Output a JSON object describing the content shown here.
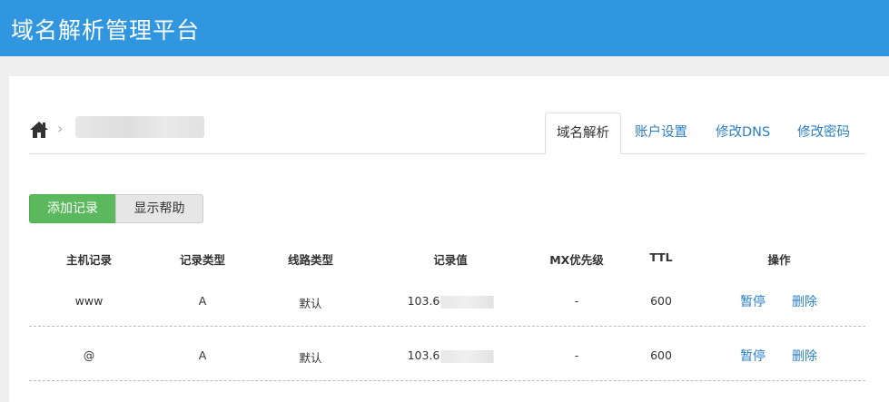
{
  "header": {
    "title": "域名解析管理平台"
  },
  "breadcrumb": {
    "home_icon": "home-icon",
    "separator": "›",
    "domain": ""
  },
  "tabs": [
    {
      "label": "域名解析",
      "active": true
    },
    {
      "label": "账户设置",
      "active": false
    },
    {
      "label": "修改DNS",
      "active": false
    },
    {
      "label": "修改密码",
      "active": false
    }
  ],
  "toolbar": {
    "add_label": "添加记录",
    "help_label": "显示帮助"
  },
  "table": {
    "headers": [
      "主机记录",
      "记录类型",
      "线路类型",
      "记录值",
      "MX优先级",
      "TTL",
      "操作"
    ],
    "rows": [
      {
        "host": "www",
        "type": "A",
        "line": "默认",
        "value": "103.6",
        "mx": "-",
        "ttl": "600",
        "pause": "暂停",
        "delete": "删除"
      },
      {
        "host": "@",
        "type": "A",
        "line": "默认",
        "value": "103.6",
        "mx": "-",
        "ttl": "600",
        "pause": "暂停",
        "delete": "删除"
      }
    ]
  },
  "colors": {
    "brand": "#3096e0",
    "link": "#2a7fc4",
    "success": "#5cb85c"
  }
}
